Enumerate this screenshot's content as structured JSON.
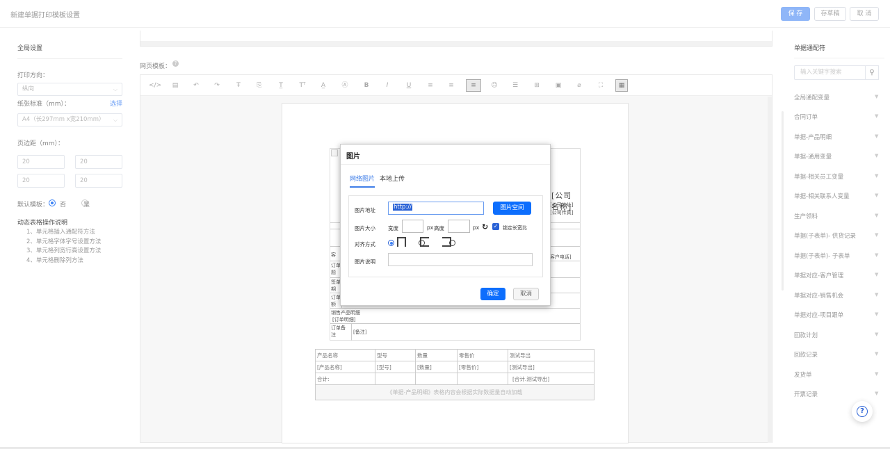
{
  "header": {
    "title": "新建单据打印模板设置",
    "save": "保 存",
    "draft": "存草稿",
    "cancel": "取 消"
  },
  "left": {
    "global_title": "全局设置",
    "orientation_label": "打印方向：",
    "orientation_value": "纵向",
    "paper_label": "纸张标准（mm）：",
    "paper_choose": "选择",
    "paper_value": "A4（长297mm x宽210mm）",
    "margin_label": "页边距（mm）：",
    "margins": [
      "20",
      "20",
      "20",
      "20"
    ],
    "default_label": "默认模板：",
    "default_no": "否",
    "default_yes": "是",
    "dynamic_title": "动态表格操作说明",
    "dynamic_items": [
      "1、单元格插入通配符方法",
      "2、单元格字体字号设置方法",
      "3、单元格列宽行高设置方法",
      "4、单元格删除列方法"
    ]
  },
  "editor": {
    "label": "网页模板：",
    "toolbar_icons": [
      "code-icon",
      "template-icon",
      "undo-icon",
      "redo-icon",
      "format-icon",
      "paste-icon",
      "underline-text-icon",
      "font-size-icon",
      "font-color-icon",
      "background-color-icon",
      "bold-icon",
      "italic-icon",
      "underline-icon",
      "align-left-icon",
      "align-center-icon",
      "align-right-icon",
      "emoji-icon",
      "hr-icon",
      "table-icon",
      "image-icon",
      "attachment-icon",
      "fullscreen-icon",
      "grid-icon"
    ]
  },
  "doc": {
    "company_name": "[公司名称]",
    "company_address": "[公司地址]",
    "company_fax": "[公司传真]",
    "customer_phone": "[客户电话]",
    "side_labels": [
      "客",
      "订单\n题",
      "签单\n期",
      "订单\n额"
    ],
    "product_detail_label": "销售产品明细",
    "product_detail_value": "[订单明细]",
    "remark_label": "订单备\n注",
    "remark_value": "[备注]",
    "product_table": {
      "headers": [
        "产品名称",
        "型号",
        "数量",
        "零售价",
        "测试导出"
      ],
      "row": [
        "[产品名称]",
        "[型号]",
        "[数量]",
        "[零售价]",
        "[测试导出]"
      ],
      "total_label": "合计:",
      "total_value": "[合计.测试导出]",
      "note": "《单据-产品明细》表格内容会根据实际数据量自动加载"
    }
  },
  "dialog": {
    "title": "图片",
    "tab_web": "网络图片",
    "tab_local": "本地上传",
    "url_label": "图片地址",
    "url_value": "http://",
    "space_btn": "图片空间",
    "size_label": "图片大小",
    "width_label": "宽度",
    "px1": "px",
    "height_label": "高度",
    "px2": "px",
    "lock_label": "锁定长宽比",
    "align_label": "对齐方式",
    "desc_label": "图片说明",
    "ok": "确定",
    "cancel": "取消"
  },
  "right": {
    "title": "单据通配符",
    "search_placeholder": "输入关键字搜索",
    "items": [
      "全局通配变量",
      "合同订单",
      "单据-产品明细",
      "单据-通用变量",
      "单据-相关员工变量",
      "单据-相关联系人变量",
      "生产领料",
      "单据(子表单)- 供货记录",
      "单据(子表单)- 子表单",
      "单据对应-客户管理",
      "单据对应-销售机会",
      "单据对应-项目跟单",
      "回款计划",
      "回款记录",
      "发货单",
      "开票记录"
    ]
  },
  "colors": {
    "primary": "#3f7ee8",
    "save_btn": "#8fb6f8",
    "ok_btn": "#0d6efd"
  }
}
